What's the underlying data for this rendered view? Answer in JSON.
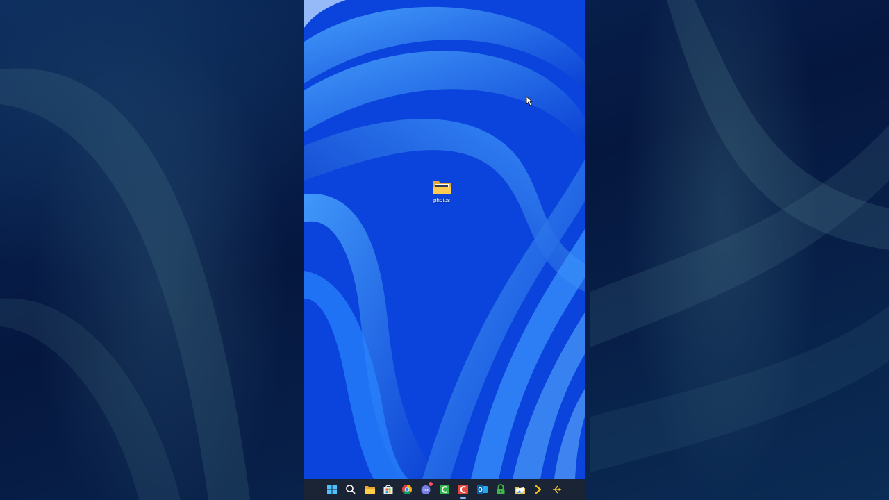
{
  "desktop": {
    "icons": [
      {
        "label": "photos",
        "icon": "folder-icon"
      }
    ]
  },
  "taskbar": {
    "items": [
      {
        "name": "start",
        "icon": "windows-logo-icon"
      },
      {
        "name": "search",
        "icon": "search-icon"
      },
      {
        "name": "file-explorer",
        "icon": "folder-icon"
      },
      {
        "name": "microsoft-store",
        "icon": "store-icon"
      },
      {
        "name": "chrome",
        "icon": "chrome-icon"
      },
      {
        "name": "chat",
        "icon": "chat-icon",
        "badge": true
      },
      {
        "name": "camtasia-green",
        "icon": "c-green-icon"
      },
      {
        "name": "camtasia-red",
        "icon": "c-red-icon",
        "active": true
      },
      {
        "name": "outlook",
        "icon": "outlook-icon"
      },
      {
        "name": "lock",
        "icon": "lock-icon"
      },
      {
        "name": "photos-folder",
        "icon": "photo-folder-icon"
      },
      {
        "name": "terminal",
        "icon": "chevron-right-icon"
      },
      {
        "name": "pin",
        "icon": "pin-icon"
      }
    ]
  },
  "colors": {
    "wallpaper": "#0b46e0",
    "taskbar": "#1b2434",
    "side": "#061a45"
  }
}
